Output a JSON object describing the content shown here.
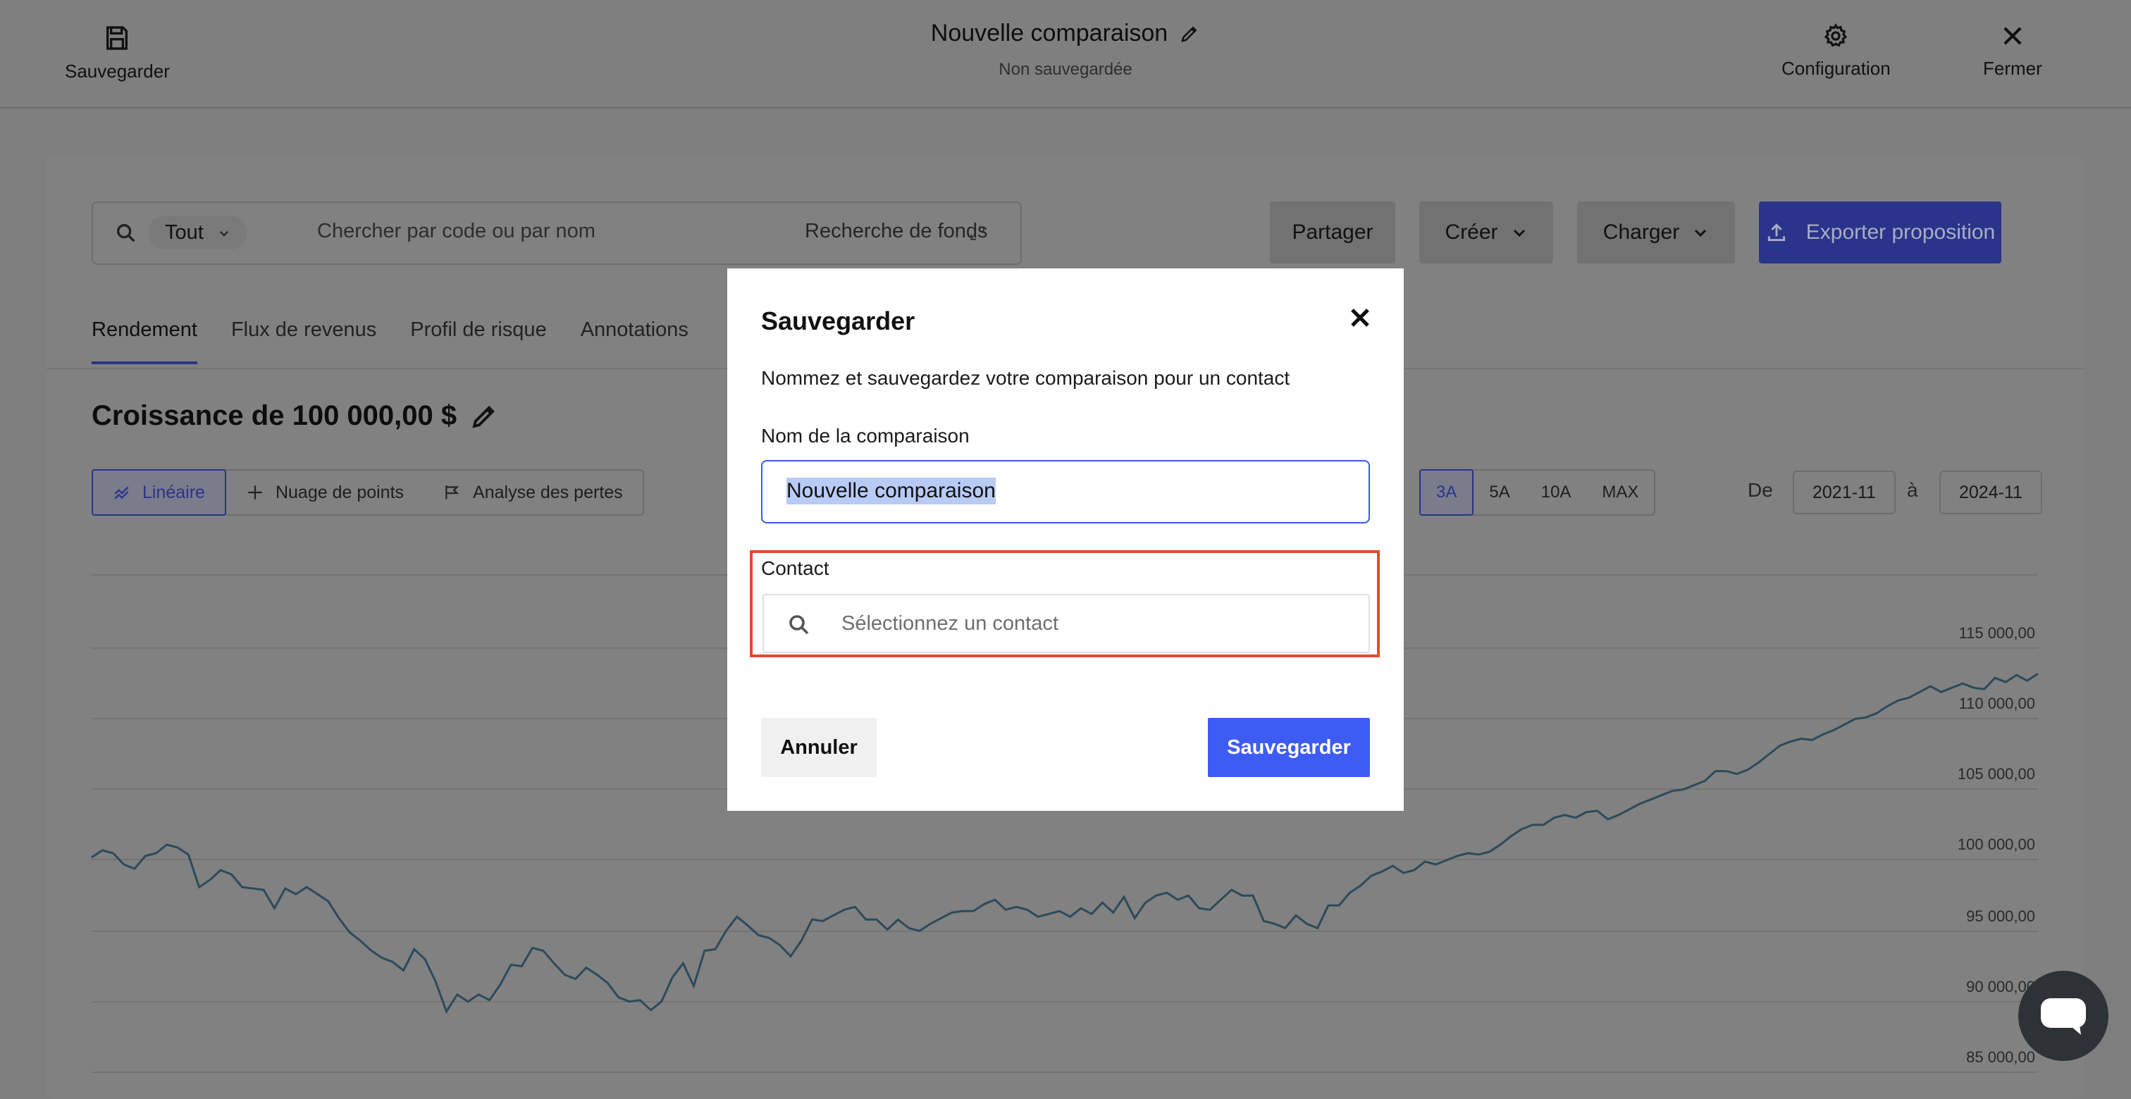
{
  "header": {
    "save_label": "Sauvegarder",
    "title": "Nouvelle comparaison",
    "status": "Non sauvegardée",
    "config_label": "Configuration",
    "close_label": "Fermer"
  },
  "toolbar": {
    "filter_value": "Tout",
    "search_placeholder": "Chercher par code ou par nom",
    "fund_search_label": "Recherche de fonds",
    "share_label": "Partager",
    "create_label": "Créer",
    "load_label": "Charger",
    "export_label": "Exporter proposition"
  },
  "tabs": [
    {
      "label": "Rendement",
      "active": true
    },
    {
      "label": "Flux de revenus"
    },
    {
      "label": "Profil de risque"
    },
    {
      "label": "Annotations"
    }
  ],
  "section": {
    "title": "Croissance de 100 000,00 $"
  },
  "view_options": [
    {
      "label": "Linéaire",
      "active": true,
      "icon": "line-chart-icon"
    },
    {
      "label": "Nuage de points",
      "icon": "scatter-icon"
    },
    {
      "label": "Analyse des pertes",
      "icon": "drawdown-icon"
    }
  ],
  "periods": [
    {
      "label": "3A",
      "active": true
    },
    {
      "label": "5A"
    },
    {
      "label": "10A"
    },
    {
      "label": "MAX"
    }
  ],
  "date_range": {
    "from_label": "De",
    "from": "2021-11",
    "to_label": "à",
    "to": "2024-11"
  },
  "chart_data": {
    "type": "line",
    "ylim": [
      85000,
      115000
    ],
    "y_ticks": [
      "115 000,00",
      "110 000,00",
      "105 000,00",
      "100 000,00",
      "95 000,00",
      "90 000,00",
      "85 000,00"
    ],
    "series": [
      {
        "values": [
          99500,
          100000,
          99800,
          99000,
          98700,
          99600,
          99800,
          100400,
          100200,
          99700,
          97400,
          97900,
          98600,
          98300,
          97400,
          97300,
          97200,
          95900,
          97300,
          96900,
          97400,
          96900,
          96400,
          95200,
          94200,
          93600,
          92900,
          92400,
          92100,
          91500,
          93000,
          92300,
          90700,
          88600,
          89800,
          89300,
          89800,
          89400,
          90500,
          91900,
          91800,
          93100,
          92900,
          92000,
          91200,
          90900,
          91700,
          91200,
          90600,
          89600,
          89300,
          89400,
          88700,
          89300,
          91000,
          92000,
          90400,
          92900,
          93000,
          94300,
          95300,
          94700,
          94000,
          93800,
          93300,
          92500,
          93600,
          95100,
          95000,
          95400,
          95800,
          96000,
          95100,
          95100,
          94400,
          95100,
          94500,
          94300,
          94800,
          95200,
          95600,
          95700,
          95700,
          96200,
          96500,
          95800,
          96000,
          95800,
          95300,
          95500,
          95700,
          95300,
          95900,
          95500,
          96300,
          95600,
          96700,
          95200,
          96300,
          96800,
          97000,
          96500,
          96800,
          95900,
          95800,
          96500,
          97200,
          96800,
          96800,
          95000,
          94800,
          94500,
          95400,
          94800,
          94500,
          96100,
          96100,
          97000,
          97500,
          98200,
          98500,
          98900,
          98400,
          98600,
          99200,
          99000,
          99300,
          99600,
          99800,
          99700,
          99900,
          100400,
          101000,
          101500,
          101800,
          101800,
          102300,
          102500,
          102300,
          102700,
          102800,
          102200,
          102500,
          102900,
          103300,
          103600,
          103900,
          104200,
          104300,
          104600,
          104900,
          105600,
          105600,
          105400,
          105700,
          106200,
          106800,
          107400,
          107700,
          107900,
          107800,
          108200,
          108500,
          108900,
          109300,
          109400,
          109700,
          110200,
          110600,
          110800,
          111200,
          111600,
          111200,
          111500,
          111800,
          111500,
          111400,
          112200,
          111900,
          112400,
          112000,
          112500
        ]
      }
    ]
  },
  "modal": {
    "title": "Sauvegarder",
    "description": "Nommez et sauvegardez votre comparaison pour un contact",
    "name_label": "Nom de la comparaison",
    "name_value": "Nouvelle comparaison",
    "contact_label": "Contact",
    "contact_placeholder": "Sélectionnez un contact",
    "cancel_label": "Annuler",
    "save_label": "Sauvegarder"
  }
}
